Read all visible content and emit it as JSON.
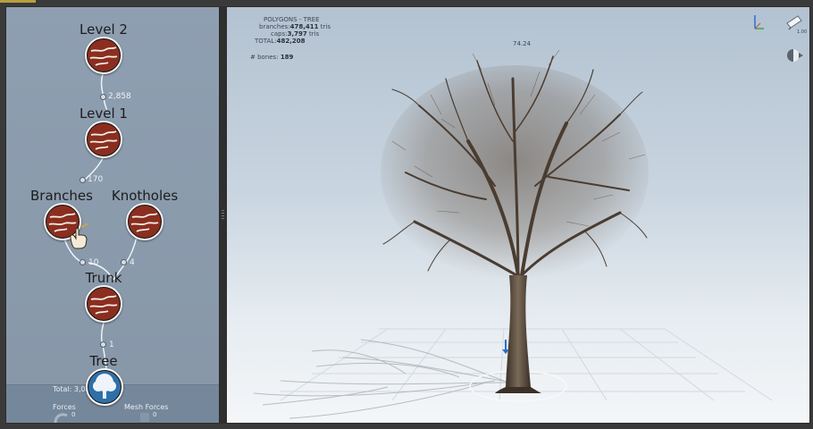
{
  "nodes": {
    "level2": {
      "label": "Level 2"
    },
    "level1": {
      "label": "Level 1"
    },
    "branches": {
      "label": "Branches"
    },
    "knotholes": {
      "label": "Knotholes"
    },
    "trunk": {
      "label": "Trunk"
    },
    "tree": {
      "label": "Tree"
    }
  },
  "wire_counts": {
    "level2_level1": "2,858",
    "level1_branches": "170",
    "branches_trunk": "10",
    "knotholes_trunk": "4",
    "trunk_tree": "1"
  },
  "bottom_bar": {
    "total": "Total: 3,044",
    "forces_label": "Forces",
    "forces_count": "0",
    "mesh_forces_label": "Mesh Forces",
    "mesh_forces_count": "0"
  },
  "stats": {
    "heading": "POLYGONS - TREE",
    "branches_label": "branches:",
    "branches_value": "478,411",
    "branches_unit": "tris",
    "caps_label": "caps:",
    "caps_value": "3,797",
    "caps_unit": "tris",
    "total_label": "TOTAL:",
    "total_value": "482,208",
    "bones_label": "# bones:",
    "bones_value": "189"
  },
  "viewport": {
    "height_readout": "74.24",
    "camera_readout": "1.00"
  },
  "icons": {
    "node_icon": "wood-grain-icon",
    "tree_icon": "tree-icon",
    "axis": "axis-gizmo-icon",
    "camera": "camera-icon",
    "lighting": "light-icon",
    "cursor": "hand-cursor-icon"
  },
  "colors": {
    "node_fill": "#8b2e1f",
    "panel_bg": "#8e9fb1",
    "tree_node_fill": "#2f6fa8"
  }
}
